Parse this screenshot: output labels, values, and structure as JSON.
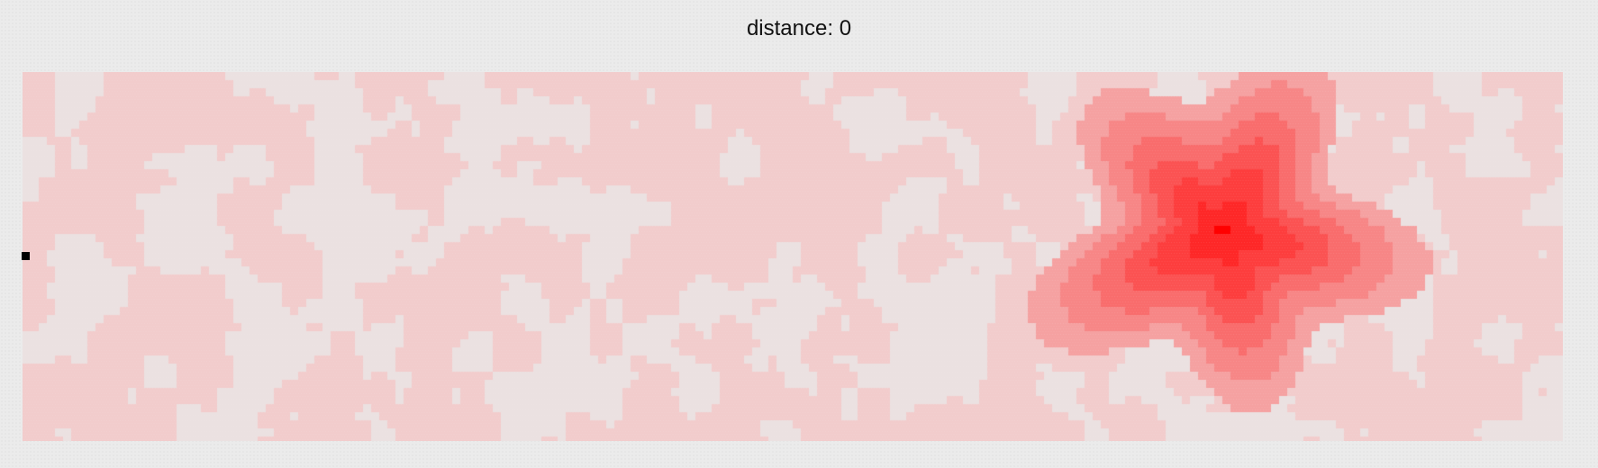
{
  "readout": {
    "label": "distance:",
    "value": "0"
  },
  "grid": {
    "tile_color": "#f2cccc",
    "empty_color": "#ebe1e1",
    "heat_color": "#ff1e1e"
  },
  "agent": {
    "icon": "square-marker",
    "color": "#000000"
  }
}
